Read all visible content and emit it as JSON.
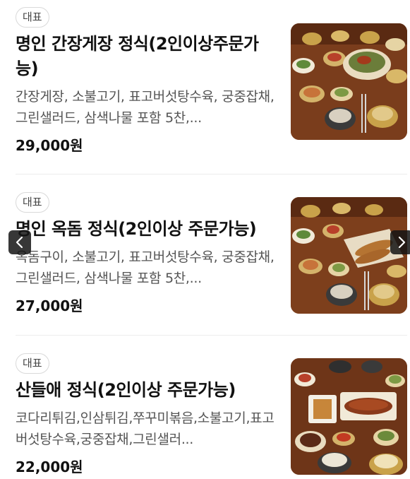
{
  "menu": {
    "items": [
      {
        "badge": "대표",
        "title": "명인 간장게장 정식(2인이상주문가능)",
        "description": "간장게장, 소불고기, 표고버섯탕수육, 궁중잡채, 그린샐러드, 삼색나물 포함 5찬,...",
        "price": "29,000원",
        "image": "korean-set-meal-crab"
      },
      {
        "badge": "대표",
        "title": "명인 옥돔 정식(2인이상 주문가능)",
        "description": "옥돔구이, 소불고기, 표고버섯탕수육, 궁중잡채, 그린샐러드, 삼색나물 포함 5찬,...",
        "price": "27,000원",
        "image": "korean-set-meal-fish"
      },
      {
        "badge": "대표",
        "title": "산들애 정식(2인이상 주문가능)",
        "description": "코다리튀김,인삼튀김,쭈꾸미볶음,소불고기,표고버섯탕수육,궁중잡채,그린샐러...",
        "price": "22,000원",
        "image": "korean-set-meal-fried"
      }
    ]
  },
  "carousel": {
    "prev_icon": "chevron-left-icon",
    "next_icon": "chevron-right-icon"
  },
  "colors": {
    "text": "#111111",
    "description": "#555555",
    "badge_border": "#d9d9d9",
    "divider": "#ececec",
    "table_wood": "#8a4a22"
  }
}
